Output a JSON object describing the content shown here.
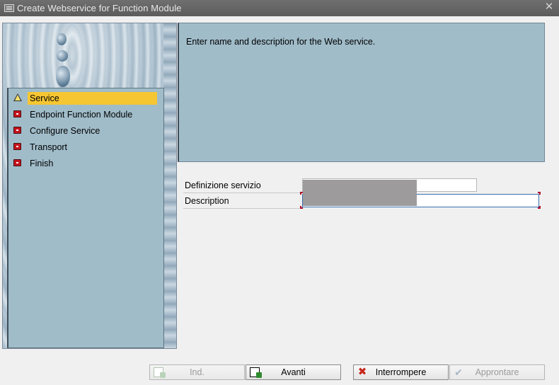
{
  "window": {
    "title": "Create Webservice for Function Module",
    "close_symbol": "✕"
  },
  "steps": [
    {
      "label": "Service",
      "status": "warning",
      "active": true
    },
    {
      "label": "Endpoint Function Module",
      "status": "pending",
      "active": false
    },
    {
      "label": "Configure Service",
      "status": "pending",
      "active": false
    },
    {
      "label": "Transport",
      "status": "pending",
      "active": false
    },
    {
      "label": "Finish",
      "status": "pending",
      "active": false
    }
  ],
  "description": {
    "text": "Enter name and description for the Web service."
  },
  "form": {
    "service_definition": {
      "label": "Definizione servizio",
      "value": ""
    },
    "description_field": {
      "label": "Description",
      "value": ""
    }
  },
  "buttons": {
    "back": {
      "label": "Ind.",
      "enabled": false
    },
    "next": {
      "label": "Avanti",
      "enabled": true
    },
    "cancel": {
      "label": "Interrompere",
      "enabled": true
    },
    "complete": {
      "label": "Approntare",
      "enabled": false
    }
  },
  "colors": {
    "active_step": "#f6c632",
    "panel_bg": "#a0bcc9",
    "title_bar": "#5f5f5f",
    "stop_icon": "#c5131d"
  }
}
